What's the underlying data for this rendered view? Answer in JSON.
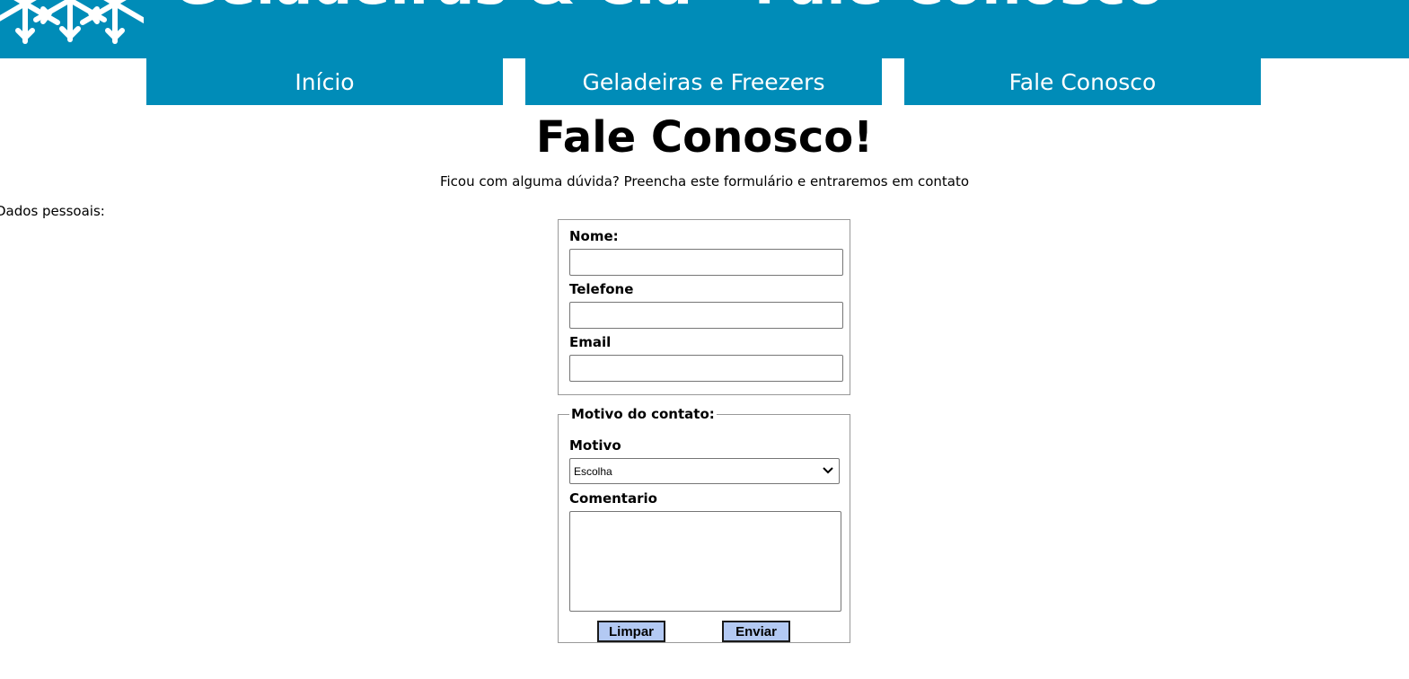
{
  "header": {
    "title": "Geladeiras & Cia - Fale Conosco",
    "logo_icon": "snowflake-icon",
    "background_color": "#008cb8"
  },
  "nav": {
    "items": [
      {
        "label": "Início"
      },
      {
        "label": "Geladeiras e Freezers"
      },
      {
        "label": "Fale Conosco"
      }
    ]
  },
  "main": {
    "title": "Fale Conosco!",
    "subtitle": "Ficou com alguma dúvida? Preencha este formulário e entraremos em contato",
    "side_label": "Dados pessoais:"
  },
  "personal": {
    "name_label": "Nome:",
    "name_value": "",
    "phone_label": "Telefone",
    "phone_value": "",
    "email_label": "Email",
    "email_value": ""
  },
  "contact": {
    "legend": "Motivo do contato:",
    "reason_label": "Motivo",
    "reason_selected": "Escolha",
    "comment_label": "Comentario",
    "comment_value": ""
  },
  "buttons": {
    "reset_label": "Limpar",
    "submit_label": "Enviar",
    "button_color": "#b3c9f3"
  }
}
